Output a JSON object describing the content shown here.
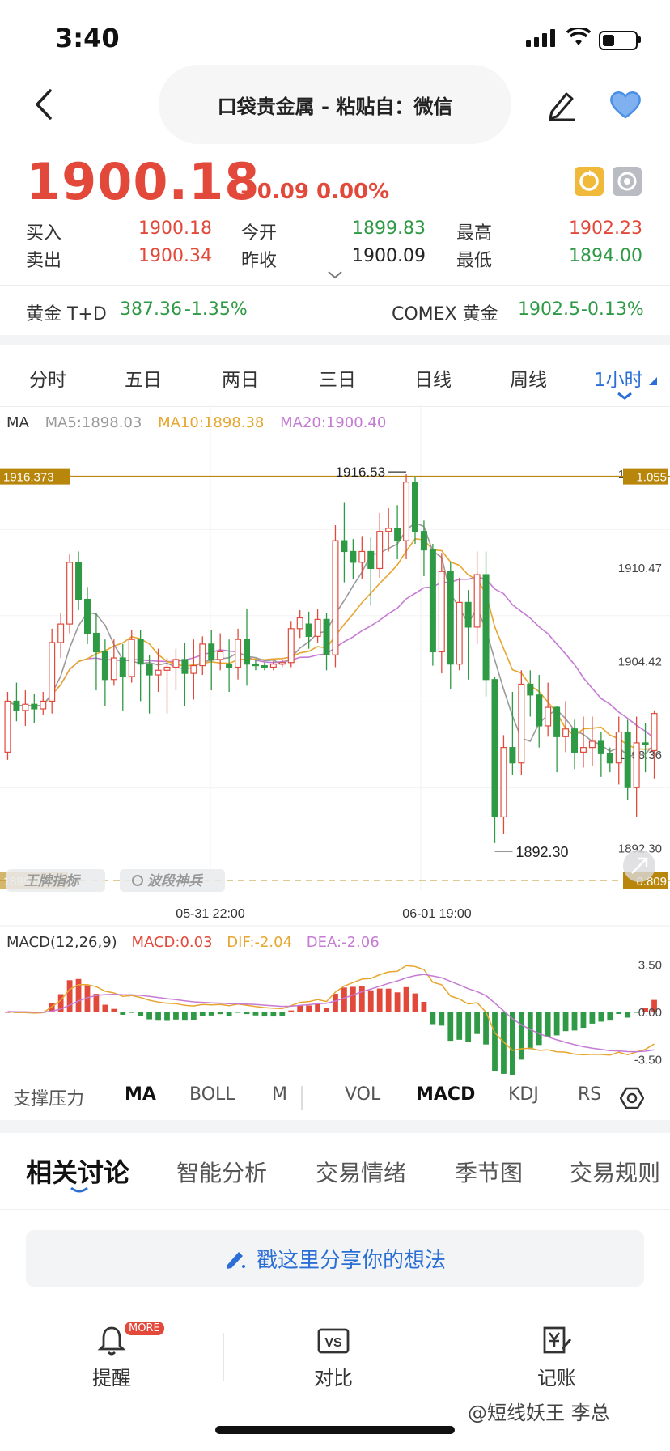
{
  "status": {
    "time": "3:40"
  },
  "nav": {
    "title": "口袋贵金属 - 粘贴自：微信"
  },
  "quote": {
    "price": "1900.18",
    "change": "+0.09 0.00%",
    "buy_label": "买入",
    "buy": "1900.18",
    "sell_label": "卖出",
    "sell": "1900.34",
    "open_label": "今开",
    "open": "1899.83",
    "prev_label": "昨收",
    "prev": "1900.09",
    "high_label": "最高",
    "high": "1902.23",
    "low_label": "最低",
    "low": "1894.00"
  },
  "markets": [
    {
      "name": "黄金 T+D",
      "value": "387.36",
      "change": "-1.35%"
    },
    {
      "name": "COMEX 黄金",
      "value": "1902.5",
      "change": "-0.13%"
    }
  ],
  "period_tabs": [
    "分时",
    "五日",
    "两日",
    "三日",
    "日线",
    "周线",
    "1小时"
  ],
  "ma_legend": {
    "label": "MA",
    "ma5": "MA5:1898.03",
    "ma10": "MA10:1898.38",
    "ma20": "MA20:1900.40"
  },
  "chart_labels": {
    "left_price_tag": "1916.373",
    "right_price_tag": "1.055",
    "max_marker": "1916.53",
    "min_marker": "1892.30",
    "bottom_left_tag": "1899.02",
    "bottom_right_tag": "0.809",
    "badge1": "王牌指标",
    "badge2": "波段神兵",
    "time1": "05-31 22:00",
    "time2": "06-01 19:00"
  },
  "macd_legend": {
    "label": "MACD(12,26,9)",
    "macd": "MACD:0.03",
    "dif": "DIF:-2.04",
    "dea": "DEA:-2.06"
  },
  "indicator_tabs": [
    "支撑压力",
    "MA",
    "BOLL",
    "M",
    "VOL",
    "MACD",
    "KDJ",
    "RS"
  ],
  "discussion_tabs": [
    "相关讨论",
    "智能分析",
    "交易情绪",
    "季节图",
    "交易规则"
  ],
  "share_placeholder": "戳这里分享你的想法",
  "bottom_bar": {
    "remind": "提醒",
    "more_badge": "MORE",
    "compare": "对比",
    "compare_icon_text": "VS",
    "ledger": "记账"
  },
  "watermark": "@短线妖王 李总",
  "colors": {
    "up": "#e2493b",
    "down": "#2f9a45",
    "accent": "#2b6fd6",
    "ma5": "#9a9a9a",
    "ma10": "#e6a630",
    "ma20": "#c57ad4",
    "gold_line": "#b8860b"
  },
  "chart_data": {
    "type": "candlestick",
    "y_axis_ticks": [
      "1916.55",
      "1910.47",
      "1904.42",
      "1898.36",
      "1892.30"
    ],
    "ylim": [
      1890.6,
      1918.5
    ],
    "x_labels": [
      "05-31 22:00",
      "06-01 19:00"
    ],
    "candles": [
      [
        1898.5,
        1901.8,
        1898.0,
        1902.4
      ],
      [
        1901.8,
        1901.2,
        1900.5,
        1903.0
      ],
      [
        1901.2,
        1901.6,
        1900.2,
        1902.5
      ],
      [
        1901.6,
        1901.3,
        1900.4,
        1902.3
      ],
      [
        1901.3,
        1901.8,
        1900.9,
        1902.4
      ],
      [
        1901.8,
        1905.6,
        1901.0,
        1906.5
      ],
      [
        1905.6,
        1906.8,
        1904.6,
        1907.5
      ],
      [
        1906.8,
        1910.8,
        1906.2,
        1911.3
      ],
      [
        1910.8,
        1908.4,
        1907.7,
        1911.5
      ],
      [
        1908.4,
        1906.2,
        1905.5,
        1909.2
      ],
      [
        1906.2,
        1905.0,
        1902.5,
        1907.5
      ],
      [
        1905.0,
        1903.2,
        1901.5,
        1905.8
      ],
      [
        1903.2,
        1904.6,
        1902.8,
        1905.8
      ],
      [
        1904.6,
        1903.4,
        1901.2,
        1905.5
      ],
      [
        1903.4,
        1905.8,
        1903.0,
        1906.4
      ],
      [
        1905.8,
        1904.2,
        1901.8,
        1906.4
      ],
      [
        1904.2,
        1903.5,
        1901.0,
        1904.8
      ],
      [
        1903.5,
        1903.8,
        1902.4,
        1905.2
      ],
      [
        1903.8,
        1904.0,
        1901.0,
        1904.6
      ],
      [
        1904.0,
        1904.5,
        1902.5,
        1905.2
      ],
      [
        1904.5,
        1903.6,
        1901.5,
        1905.6
      ],
      [
        1903.6,
        1904.1,
        1901.9,
        1905.8
      ],
      [
        1904.1,
        1905.5,
        1903.5,
        1906.0
      ],
      [
        1905.5,
        1904.5,
        1902.5,
        1906.4
      ],
      [
        1904.5,
        1905.0,
        1903.8,
        1906.2
      ],
      [
        1904.2,
        1904.0,
        1902.4,
        1905.8
      ],
      [
        1904.0,
        1905.8,
        1903.2,
        1906.5
      ],
      [
        1905.8,
        1904.2,
        1902.8,
        1907.8
      ],
      [
        1904.2,
        1904.1,
        1903.8,
        1904.5
      ],
      [
        1904.1,
        1904.0,
        1903.8,
        1904.3
      ],
      [
        1904.0,
        1904.2,
        1903.8,
        1904.4
      ],
      [
        1904.2,
        1904.3,
        1904.0,
        1904.5
      ],
      [
        1904.3,
        1906.5,
        1904.0,
        1907.0
      ],
      [
        1906.5,
        1907.2,
        1905.9,
        1907.7
      ],
      [
        1906.8,
        1906.0,
        1905.2,
        1907.6
      ],
      [
        1906.0,
        1907.1,
        1905.6,
        1907.8
      ],
      [
        1907.1,
        1904.8,
        1903.8,
        1907.5
      ],
      [
        1904.8,
        1912.2,
        1904.0,
        1913.2
      ],
      [
        1912.2,
        1911.5,
        1909.5,
        1914.7
      ],
      [
        1911.5,
        1910.8,
        1909.7,
        1912.3
      ],
      [
        1910.8,
        1911.5,
        1909.7,
        1912.5
      ],
      [
        1911.5,
        1910.4,
        1908.0,
        1912.4
      ],
      [
        1910.4,
        1912.8,
        1909.8,
        1914.0
      ],
      [
        1912.8,
        1913.0,
        1911.5,
        1914.3
      ],
      [
        1913.0,
        1912.2,
        1911.0,
        1914.5
      ],
      [
        1912.2,
        1916.0,
        1911.0,
        1916.5
      ],
      [
        1916.0,
        1912.8,
        1912.0,
        1916.3
      ],
      [
        1912.8,
        1911.6,
        1909.9,
        1913.5
      ],
      [
        1911.6,
        1905.0,
        1904.1,
        1912.0
      ],
      [
        1905.0,
        1910.2,
        1903.6,
        1911.4
      ],
      [
        1910.2,
        1904.2,
        1902.6,
        1910.8
      ],
      [
        1904.2,
        1908.2,
        1903.8,
        1909.8
      ],
      [
        1908.2,
        1906.6,
        1903.2,
        1909.0
      ],
      [
        1906.6,
        1910.0,
        1905.5,
        1911.5
      ],
      [
        1910.0,
        1903.2,
        1902.1,
        1911.5
      ],
      [
        1903.2,
        1894.3,
        1892.6,
        1903.4
      ],
      [
        1894.3,
        1898.8,
        1893.2,
        1899.6
      ],
      [
        1898.8,
        1897.8,
        1897.0,
        1902.4
      ],
      [
        1897.8,
        1902.9,
        1897.0,
        1903.8
      ],
      [
        1902.9,
        1902.2,
        1900.8,
        1903.8
      ],
      [
        1902.2,
        1900.2,
        1898.8,
        1903.5
      ],
      [
        1900.2,
        1901.4,
        1899.5,
        1903.0
      ],
      [
        1901.4,
        1899.5,
        1897.2,
        1901.5
      ],
      [
        1899.5,
        1900.0,
        1898.5,
        1901.8
      ],
      [
        1900.0,
        1898.5,
        1897.4,
        1900.6
      ],
      [
        1898.5,
        1898.8,
        1897.5,
        1900.8
      ],
      [
        1898.8,
        1899.2,
        1897.6,
        1900.8
      ],
      [
        1899.2,
        1898.4,
        1896.9,
        1899.8
      ],
      [
        1898.4,
        1897.8,
        1897.2,
        1898.8
      ],
      [
        1897.8,
        1899.8,
        1896.4,
        1900.8
      ],
      [
        1899.8,
        1896.2,
        1895.4,
        1900.6
      ],
      [
        1896.2,
        1899.1,
        1894.3,
        1900.8
      ],
      [
        1899.1,
        1899.0,
        1897.2,
        1900.4
      ],
      [
        1898.6,
        1901.0,
        1896.8,
        1901.2
      ]
    ],
    "macd_ylim": [
      -4.2,
      4.2
    ],
    "macd_ticks": [
      "3.50",
      "0.00",
      "-3.50"
    ]
  }
}
